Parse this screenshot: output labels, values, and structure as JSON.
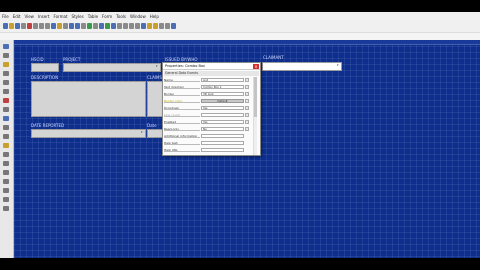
{
  "menubar": [
    "File",
    "Edit",
    "View",
    "Insert",
    "Format",
    "Styles",
    "Table",
    "Form",
    "Tools",
    "Window",
    "Help"
  ],
  "canvas": {
    "labels": {
      "hscid": "HSCID",
      "project": "PROJECT",
      "issued_by": "ISSUED BY/WHO",
      "claimant": "CLAIMANT",
      "description": "DESCRIPTION",
      "claims": "CLAIMS",
      "date_reported": "DATE REPORTED",
      "date": "Date"
    }
  },
  "dialog": {
    "title": "Properties: Combo Box",
    "section": "General   Data   Events",
    "rows": [
      {
        "key": "Name",
        "value": "List"
      },
      {
        "key": "Text direction",
        "value": "Combo Box 1"
      },
      {
        "key": "Border",
        "value": "3D look"
      },
      {
        "key": "Border color",
        "value": "Default"
      },
      {
        "key": "Dropdown",
        "value": "Yes"
      },
      {
        "key": "Line count",
        "value": ""
      },
      {
        "key": "Enabled",
        "value": "Yes"
      },
      {
        "key": "Read-only",
        "value": "No"
      },
      {
        "key": "Additional information",
        "value": ""
      },
      {
        "key": "Help text",
        "value": ""
      },
      {
        "key": "Help URL",
        "value": ""
      }
    ]
  },
  "colors": {
    "canvas_bg": "#0d2e8c",
    "close_button": "#d03030"
  }
}
